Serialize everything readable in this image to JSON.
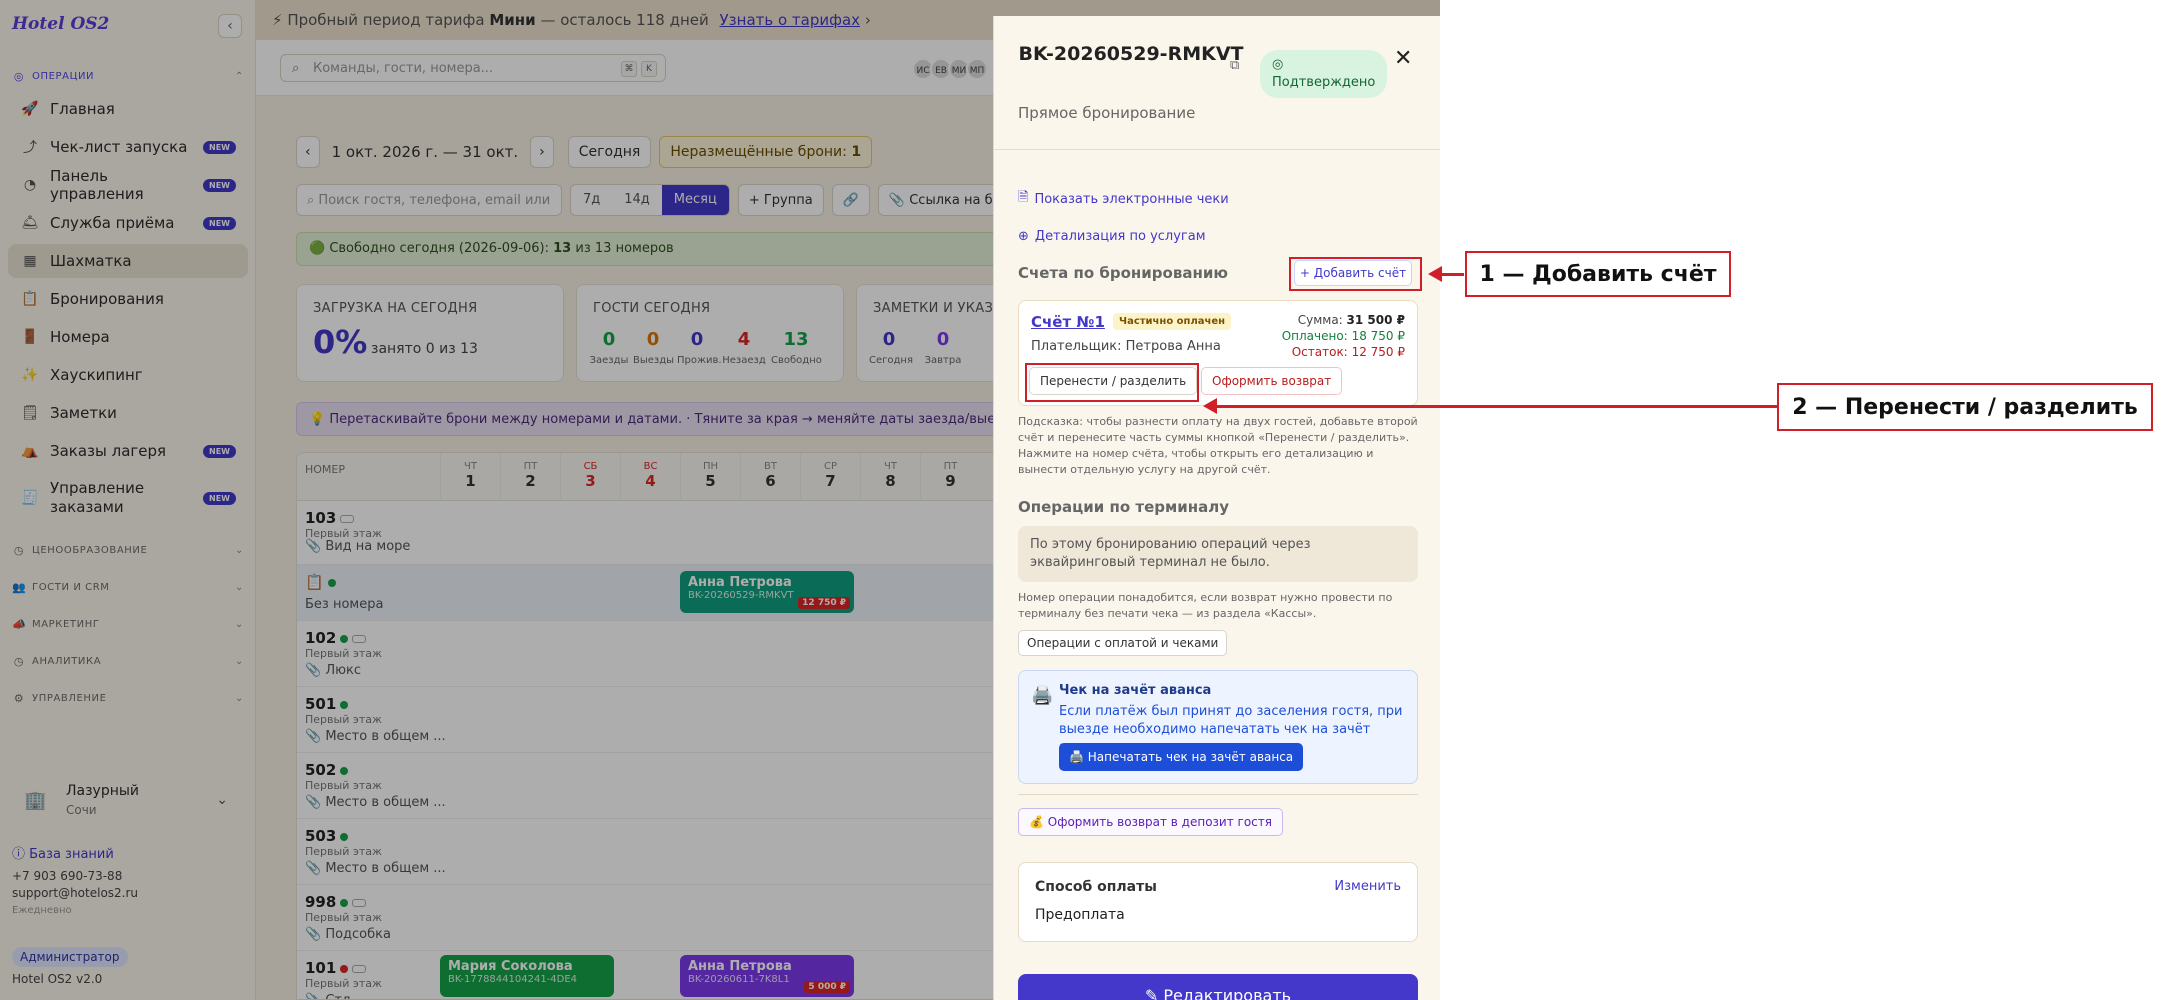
{
  "sidebar": {
    "logo": "Hotel OS2",
    "sections": {
      "ops": "ОПЕРАЦИИ",
      "pricing": "ЦЕНООБРАЗОВАНИЕ",
      "crm": "ГОСТИ И CRM",
      "marketing": "МАРКЕТИНГ",
      "analytics": "АНАЛИТИКА",
      "admin": "УПРАВЛЕНИЕ"
    },
    "items": [
      {
        "label": "Главная",
        "icon": "rocket-icon"
      },
      {
        "label": "Чек-лист запуска",
        "icon": "rocket-launch-icon",
        "badge": "NEW"
      },
      {
        "label": "Панель управления",
        "icon": "gauge-icon",
        "badge": "NEW"
      },
      {
        "label": "Служба приёма",
        "icon": "bell-icon",
        "badge": "NEW"
      },
      {
        "label": "Шахматка",
        "icon": "grid-icon"
      },
      {
        "label": "Бронирования",
        "icon": "clipboard-icon"
      },
      {
        "label": "Номера",
        "icon": "door-icon"
      },
      {
        "label": "Хаускипинг",
        "icon": "sparkles-icon"
      },
      {
        "label": "Заметки",
        "icon": "note-icon"
      },
      {
        "label": "Заказы лагеря",
        "icon": "tent-icon",
        "badge": "NEW"
      },
      {
        "label": "Управление заказами",
        "icon": "receipt-icon",
        "badge": "NEW"
      }
    ],
    "hotel": {
      "name": "Лазурный",
      "city": "Сочи"
    },
    "knowledge_base": "База знаний",
    "phone": "+7 903 690-73-88",
    "email": "support@hotelos2.ru",
    "schedule": "Ежедневно",
    "role": "Администратор",
    "version": "Hotel OS2 v2.0"
  },
  "trial": {
    "prefix": "Пробный период тарифа",
    "plan": "Мини",
    "suffix": "— осталось 118 дней",
    "link": "Узнать о тарифах",
    "arrow": "›"
  },
  "topbar": {
    "search_placeholder": "Команды, гости, номера...",
    "kbd1": "⌘",
    "kbd2": "K",
    "avatars": [
      "ИС",
      "ЕВ",
      "МИ",
      "МП"
    ]
  },
  "toolbar": {
    "prev": "‹",
    "range": "1 окт. 2026 г. — 31 окт.",
    "next": "›",
    "today": "Сегодня",
    "unplaced_label": "Неразмещённые брони:",
    "unplaced_count": "1",
    "guest_search_placeholder": "Поиск гостя, телефона, email или",
    "periods": [
      "7д",
      "14д",
      "Месяц"
    ],
    "group": "+ Группа",
    "link_label": "Ссылка на бр"
  },
  "free_today": {
    "prefix": "🟢 Свободно сегодня (2026-09-06):",
    "count": "13",
    "middle": "из",
    "total": "13",
    "suffix": "номеров"
  },
  "stats": {
    "load": {
      "title": "ЗАГРУЗКА НА СЕГОДНЯ",
      "value": "0%",
      "sub": "занято 0 из 13"
    },
    "guests": {
      "title": "ГОСТИ СЕГОДНЯ",
      "items": [
        {
          "value": "0",
          "label": "Заезды",
          "color": "#16a34a"
        },
        {
          "value": "0",
          "label": "Выезды",
          "color": "#d97706"
        },
        {
          "value": "0",
          "label": "Прожив.",
          "color": "#4338ca"
        },
        {
          "value": "4",
          "label": "Незаезд",
          "color": "#dc2626"
        },
        {
          "value": "13",
          "label": "Свободно",
          "color": "#16a34a"
        }
      ]
    },
    "notes": {
      "title": "ЗАМЕТКИ И УКАЗА",
      "items": [
        {
          "value": "0",
          "label": "Сегодня",
          "color": "#4338ca"
        },
        {
          "value": "0",
          "label": "Завтра",
          "color": "#7c3aed"
        }
      ]
    }
  },
  "hint": "💡 Перетаскивайте брони между номерами и датами. · Тяните за края → меняйте даты заезда/выезда.",
  "grid": {
    "room_header": "НОМЕР",
    "days": [
      {
        "w": "ЧТ",
        "d": "1"
      },
      {
        "w": "ПТ",
        "d": "2"
      },
      {
        "w": "СБ",
        "d": "3"
      },
      {
        "w": "ВС",
        "d": "4"
      },
      {
        "w": "ПН",
        "d": "5"
      },
      {
        "w": "ВТ",
        "d": "6"
      },
      {
        "w": "СР",
        "d": "7"
      },
      {
        "w": "ЧТ",
        "d": "8"
      },
      {
        "w": "ПТ",
        "d": "9"
      }
    ],
    "rows": [
      {
        "num": "103",
        "floor": "Первый этаж",
        "type": "📎 Вид на море"
      },
      {
        "num": "📋",
        "floor": "",
        "type": "Без номера"
      },
      {
        "num": "102",
        "floor": "Первый этаж",
        "type": "📎 Люкс"
      },
      {
        "num": "501",
        "floor": "Первый этаж",
        "type": "📎 Место в общем ..."
      },
      {
        "num": "502",
        "floor": "Первый этаж",
        "type": "📎 Место в общем ..."
      },
      {
        "num": "503",
        "floor": "Первый этаж",
        "type": "📎 Место в общем ..."
      },
      {
        "num": "998",
        "floor": "Первый этаж",
        "type": "📎 Подсобка"
      },
      {
        "num": "101",
        "floor": "Первый этаж",
        "type": "📎 Стд"
      }
    ],
    "bookings": [
      {
        "name": "Анна Петрова",
        "code": "BK-20260529-RMKVT",
        "price": "12 750 ₽",
        "color": "#0f9f7f"
      },
      {
        "name": "Мария Соколова",
        "code": "BK-1778844104241-4DE4",
        "color": "#16a34a"
      },
      {
        "name": "Анна Петрова",
        "code": "BK-20260611-7K8L1",
        "price": "5 000 ₽",
        "color": "#7c3aed"
      }
    ]
  },
  "drawer": {
    "code": "BK-20260529-RMKVT",
    "status": "Подтверждено",
    "subtitle": "Прямое бронирование",
    "receipts_link": "Показать электронные чеки",
    "services_link": "Детализация по услугам",
    "accounts_title": "Счета по бронированию",
    "add_invoice": "+ Добавить счёт",
    "invoice": {
      "name": "Счёт №1",
      "status": "Частично оплачен",
      "payer": "Плательщик: Петрова Анна",
      "sum_label": "Сумма:",
      "sum": "31 500 ₽",
      "paid_label": "Оплачено:",
      "paid": "18 750 ₽",
      "rest_label": "Остаток:",
      "rest": "12 750 ₽",
      "transfer": "Перенести / разделить",
      "refund": "Оформить возврат"
    },
    "tip": "Подсказка: чтобы разнести оплату на двух гостей, добавьте второй счёт и перенесите часть суммы кнопкой «Перенести / разделить». Нажмите на номер счёта, чтобы открыть его детализацию и вынести отдельную услугу на другой счёт.",
    "terminal_title": "Операции по терминалу",
    "terminal_empty": "По этому бронированию операций через эквайринговый терминал не было.",
    "terminal_note": "Номер операции понадобится, если возврат нужно провести по терминалу без печати чека — из раздела «Кассы».",
    "ops_button": "Операции с оплатой и чеками",
    "advance": {
      "title": "Чек на зачёт аванса",
      "desc": "Если платёж был принят до заселения гостя, при выезде необходимо напечатать чек на зачёт аванса.",
      "button": "🖨️ Напечатать чек на зачёт аванса"
    },
    "deposit_refund": "💰 Оформить возврат в депозит гостя",
    "payment": {
      "title": "Способ оплаты",
      "change": "Изменить",
      "value": "Предоплата"
    },
    "edit": "Редактировать"
  },
  "annotations": {
    "one": "1 — Добавить счёт",
    "two": "2 — Перенести / разделить"
  },
  "colors": {
    "accent": "#4338ca",
    "annotation": "#d11f2a"
  }
}
